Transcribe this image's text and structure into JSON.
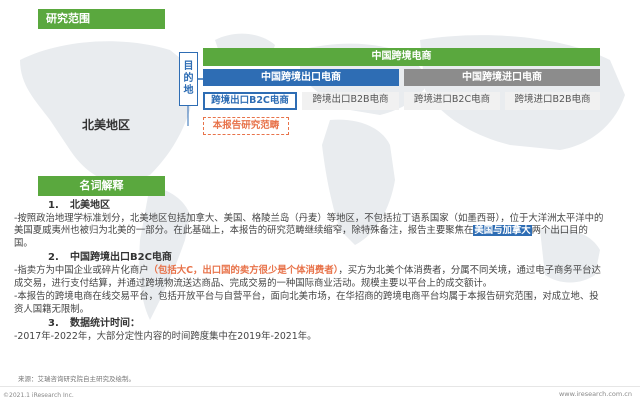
{
  "diagram": {
    "scope_header": "研究范围",
    "purpose_chars": [
      "目",
      "的",
      "地"
    ],
    "north_america_label": "北美地区",
    "cross_border": {
      "title": "中国跨境电商",
      "export": {
        "title": "中国跨境出口电商",
        "items": [
          "跨境出口B2C电商",
          "跨境出口B2B电商"
        ]
      },
      "import": {
        "title": "中国跨境进口电商",
        "items": [
          "跨境进口B2C电商",
          "跨境进口B2B电商"
        ]
      }
    },
    "scope_note": "本报告研究范畴"
  },
  "glossary": {
    "header": "名词解释",
    "sections": [
      {
        "num": "1.",
        "title": "北美地区",
        "text_a": "-按照政治地理学标准划分，北美地区包括加拿大、美国、格陵兰岛（丹麦）等地区，不包括拉丁语系国家（如墨西哥），位于大洋洲太平洋中的美国夏威夷州也被归为北美的一部分。在此基础上，本报告的研究范畴继续缩窄，除特殊备注，报告主要聚焦在",
        "highlight": "美国与加拿大",
        "text_b": "两个出口目的国。"
      },
      {
        "num": "2.",
        "title": "中国跨境出口B2C电商",
        "text_a": "-指卖方为中国企业或碎片化商户",
        "highlight": "（包括大C，出口国的卖方很少是个体消费者）",
        "text_b": "，买方为北美个体消费者，分属不同关境，通过电子商务平台达成交易，进行支付结算，并通过跨境物流送达商品、完成交易的一种国际商业活动。规模主要以平台上的成交额计。",
        "text_c": "-本报告的跨境电商在线交易平台，包括开放平台与自营平台，面向北美市场，在华招商的跨境电商平台均属于本报告研究范围，对成立地、投资人国籍无限制。"
      },
      {
        "num": "3.",
        "title": "数据统计时间：",
        "text_a": "-2017年-2022年，大部分定性内容的时间跨度集中在2019年-2021年。"
      }
    ]
  },
  "source": "来源：艾瑞咨询研究院自主研究及绘制。",
  "footer_left": "©2021.1 iResearch Inc.",
  "footer_right": "www.iresearch.com.cn",
  "colors": {
    "green": "#5aa83e",
    "blue": "#2e6db4",
    "grey": "#8c8c8c",
    "orange": "#e8734a"
  }
}
